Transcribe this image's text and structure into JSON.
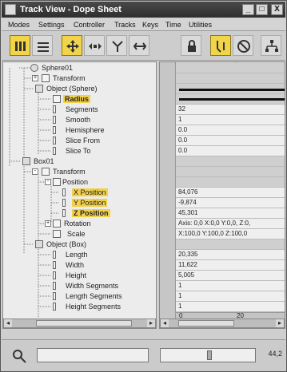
{
  "window": {
    "title": "Track View - Dope Sheet"
  },
  "titlebar": {
    "min": "_",
    "max": "□",
    "close": "X"
  },
  "menu": [
    "Modes",
    "Settings",
    "Controller",
    "Tracks",
    "Keys",
    "Time",
    "Utilities"
  ],
  "tree": [
    {
      "label": "Sphere01",
      "icon": "sphere-object-icon"
    },
    {
      "label": "Transform",
      "icon": "transform-icon"
    },
    {
      "label": "Object (Sphere)",
      "icon": "object-icon"
    },
    {
      "label": "Radius",
      "icon": "track-icon",
      "state": "selected"
    },
    {
      "label": "Segments",
      "icon": "track-icon"
    },
    {
      "label": "Smooth",
      "icon": "track-icon"
    },
    {
      "label": "Hemisphere",
      "icon": "track-icon"
    },
    {
      "label": "Slice From",
      "icon": "track-icon"
    },
    {
      "label": "Slice To",
      "icon": "track-icon"
    },
    {
      "label": "Box01",
      "icon": "box-object-icon"
    },
    {
      "label": "Transform",
      "icon": "transform-icon"
    },
    {
      "label": "Position",
      "icon": "track-icon"
    },
    {
      "label": "X Position",
      "icon": "track-icon",
      "state": "highlighted"
    },
    {
      "label": "Y Position",
      "icon": "track-icon",
      "state": "highlighted"
    },
    {
      "label": "Z Position",
      "icon": "track-icon",
      "state": "highlighted"
    },
    {
      "label": "Rotation",
      "icon": "track-icon"
    },
    {
      "label": "Scale",
      "icon": "track-icon"
    },
    {
      "label": "Object (Box)",
      "icon": "object-icon"
    },
    {
      "label": "Length",
      "icon": "track-icon"
    },
    {
      "label": "Width",
      "icon": "track-icon"
    },
    {
      "label": "Height",
      "icon": "track-icon"
    },
    {
      "label": "Width Segments",
      "icon": "track-icon"
    },
    {
      "label": "Length Segments",
      "icon": "track-icon"
    },
    {
      "label": "Height Segments",
      "icon": "track-icon"
    }
  ],
  "grid_values": [
    "",
    "",
    "",
    "",
    "32",
    "1",
    "0.0",
    "0.0",
    "0.0",
    "",
    "",
    "",
    "84,076",
    "-9,874",
    "45,301",
    "Axis: 0,0 X:0,0 Y:0,0, Z:0,",
    "X:100,0 Y:100,0 Z:100,0",
    "",
    "20,335",
    "11,622",
    "5,005",
    "1",
    "1",
    "1"
  ],
  "ruler": {
    "mark0": "0",
    "mark1": "20"
  },
  "status": {
    "zoom": "44,2"
  },
  "colors": {
    "selection": "#f2d14a",
    "titlebar": "#3a3a3a"
  }
}
